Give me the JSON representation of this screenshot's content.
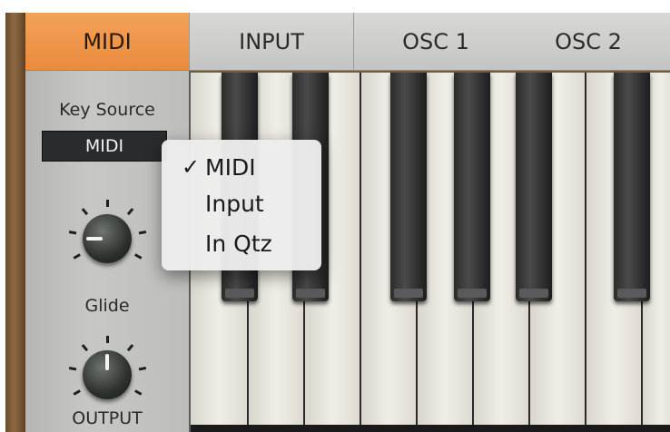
{
  "tabs": [
    {
      "label": "MIDI",
      "active": true
    },
    {
      "label": "INPUT",
      "active": false
    },
    {
      "label": "OSC 1",
      "active": false
    },
    {
      "label": "OSC 2",
      "active": false
    }
  ],
  "panel": {
    "key_source_label": "Key Source",
    "key_source_value": "MIDI",
    "glide_label": "Glide",
    "output_label": "OUTPUT",
    "glide_knob": {
      "icon": "knob-icon"
    },
    "output_knob": {
      "icon": "knob-icon"
    }
  },
  "menu": {
    "items": [
      {
        "label": "MIDI",
        "checked": true
      },
      {
        "label": "Input",
        "checked": false
      },
      {
        "label": "In Qtz",
        "checked": false
      }
    ],
    "check_glyph": "✓"
  },
  "colors": {
    "active_tab": "#e98b3c",
    "tab_bar": "#cfcfcd",
    "panel": "#bdbdbb",
    "select_bg": "#2a2b2d",
    "wood": "#7a5a38"
  }
}
